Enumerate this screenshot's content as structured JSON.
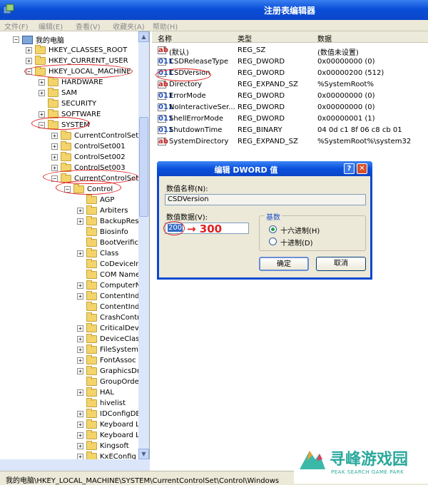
{
  "window": {
    "title": "注册表编辑器"
  },
  "menu": [
    "文件(F)",
    "编辑(E)",
    "查看(V)",
    "收藏夹(A)",
    "帮助(H)"
  ],
  "tree": {
    "items": [
      {
        "label": "我的电脑",
        "expander": "−",
        "icon": "computer-icon"
      },
      {
        "label": "HKEY_CLASSES_ROOT",
        "expander": "+",
        "icon": "folder-icon"
      },
      {
        "label": "HKEY_CURRENT_USER",
        "expander": "+",
        "icon": "folder-icon"
      },
      {
        "label": "HKEY_LOCAL_MACHINE",
        "expander": "−",
        "icon": "folder-icon"
      },
      {
        "label": "HARDWARE",
        "expander": "+",
        "icon": "folder-icon"
      },
      {
        "label": "SAM",
        "expander": "+",
        "icon": "folder-icon"
      },
      {
        "label": "SECURITY",
        "expander": "",
        "icon": "folder-icon"
      },
      {
        "label": "SOFTWARE",
        "expander": "+",
        "icon": "folder-icon"
      },
      {
        "label": "SYSTEM",
        "expander": "−",
        "icon": "folder-icon"
      },
      {
        "label": "CurrentControlSet",
        "expander": "+",
        "icon": "folder-icon"
      },
      {
        "label": "ControlSet001",
        "expander": "+",
        "icon": "folder-icon"
      },
      {
        "label": "ControlSet002",
        "expander": "+",
        "icon": "folder-icon"
      },
      {
        "label": "ControlSet003",
        "expander": "+",
        "icon": "folder-icon"
      },
      {
        "label": "CurrentControlSet",
        "expander": "−",
        "icon": "folder-icon"
      },
      {
        "label": "Control",
        "expander": "−",
        "icon": "folder-icon"
      },
      {
        "label": "AGP",
        "expander": "",
        "icon": "folder-icon"
      },
      {
        "label": "Arbiters",
        "expander": "+",
        "icon": "folder-icon"
      },
      {
        "label": "BackupResto",
        "expander": "+",
        "icon": "folder-icon"
      },
      {
        "label": "Biosinfo",
        "expander": "",
        "icon": "folder-icon"
      },
      {
        "label": "BootVerifica",
        "expander": "",
        "icon": "folder-icon"
      },
      {
        "label": "Class",
        "expander": "+",
        "icon": "folder-icon"
      },
      {
        "label": "CoDeviceIns",
        "expander": "",
        "icon": "folder-icon"
      },
      {
        "label": "COM Name A",
        "expander": "",
        "icon": "folder-icon"
      },
      {
        "label": "ComputerNa",
        "expander": "+",
        "icon": "folder-icon"
      },
      {
        "label": "ContentInde",
        "expander": "+",
        "icon": "folder-icon"
      },
      {
        "label": "ContentInde",
        "expander": "",
        "icon": "folder-icon"
      },
      {
        "label": "CrashContro",
        "expander": "",
        "icon": "folder-icon"
      },
      {
        "label": "CriticalDevic",
        "expander": "+",
        "icon": "folder-icon"
      },
      {
        "label": "DeviceClass",
        "expander": "+",
        "icon": "folder-icon"
      },
      {
        "label": "FileSystem",
        "expander": "+",
        "icon": "folder-icon"
      },
      {
        "label": "FontAssoc",
        "expander": "+",
        "icon": "folder-icon"
      },
      {
        "label": "GraphicsDriv",
        "expander": "+",
        "icon": "folder-icon"
      },
      {
        "label": "GroupOrder",
        "expander": "",
        "icon": "folder-icon"
      },
      {
        "label": "HAL",
        "expander": "+",
        "icon": "folder-icon"
      },
      {
        "label": "hivelist",
        "expander": "",
        "icon": "folder-icon"
      },
      {
        "label": "IDConfigDB",
        "expander": "+",
        "icon": "folder-icon"
      },
      {
        "label": "Keyboard La",
        "expander": "+",
        "icon": "folder-icon"
      },
      {
        "label": "Keyboard La",
        "expander": "+",
        "icon": "folder-icon"
      },
      {
        "label": "Kingsoft",
        "expander": "+",
        "icon": "folder-icon"
      },
      {
        "label": "KxEConfig",
        "expander": "+",
        "icon": "folder-icon"
      }
    ]
  },
  "list": {
    "headers": {
      "name": "名称",
      "type": "类型",
      "data": "数据"
    },
    "rows": [
      {
        "name": "(默认)",
        "type": "REG_SZ",
        "data": "(数值未设置)",
        "icon": "ab"
      },
      {
        "name": "CSDReleaseType",
        "type": "REG_DWORD",
        "data": "0x00000000 (0)",
        "icon": "bin"
      },
      {
        "name": "CSDVersion",
        "type": "REG_DWORD",
        "data": "0x00000200 (512)",
        "icon": "bin"
      },
      {
        "name": "Directory",
        "type": "REG_EXPAND_SZ",
        "data": "%SystemRoot%",
        "icon": "ab"
      },
      {
        "name": "ErrorMode",
        "type": "REG_DWORD",
        "data": "0x00000000 (0)",
        "icon": "bin"
      },
      {
        "name": "NoInteractiveSer...",
        "type": "REG_DWORD",
        "data": "0x00000000 (0)",
        "icon": "bin"
      },
      {
        "name": "ShellErrorMode",
        "type": "REG_DWORD",
        "data": "0x00000001 (1)",
        "icon": "bin"
      },
      {
        "name": "ShutdownTime",
        "type": "REG_BINARY",
        "data": "04 0d c1 8f 06 c8 cb 01",
        "icon": "bin"
      },
      {
        "name": "SystemDirectory",
        "type": "REG_EXPAND_SZ",
        "data": "%SystemRoot%\\system32",
        "icon": "ab"
      }
    ]
  },
  "dialog": {
    "title": "编辑 DWORD 值",
    "help": "?",
    "close": "✕",
    "name_label": "数值名称(N):",
    "name_value": "CSDVersion",
    "data_label": "数值数据(V):",
    "data_value": "200",
    "annotation": "→ 300",
    "base_title": "基数",
    "hex_label": "十六进制(H)",
    "dec_label": "十进制(D)",
    "ok": "确定",
    "cancel": "取消"
  },
  "status": {
    "path": "我的电脑\\HKEY_LOCAL_MACHINE\\SYSTEM\\CurrentControlSet\\Control\\Windows"
  },
  "watermark": {
    "title": "寻峰游戏园",
    "subtitle": "PEAK SEARCH GAME PARK"
  },
  "colors": {
    "xp_blue": "#0a4fd8",
    "annotation_red": "#e02020",
    "watermark_teal": "#2aa89c"
  }
}
